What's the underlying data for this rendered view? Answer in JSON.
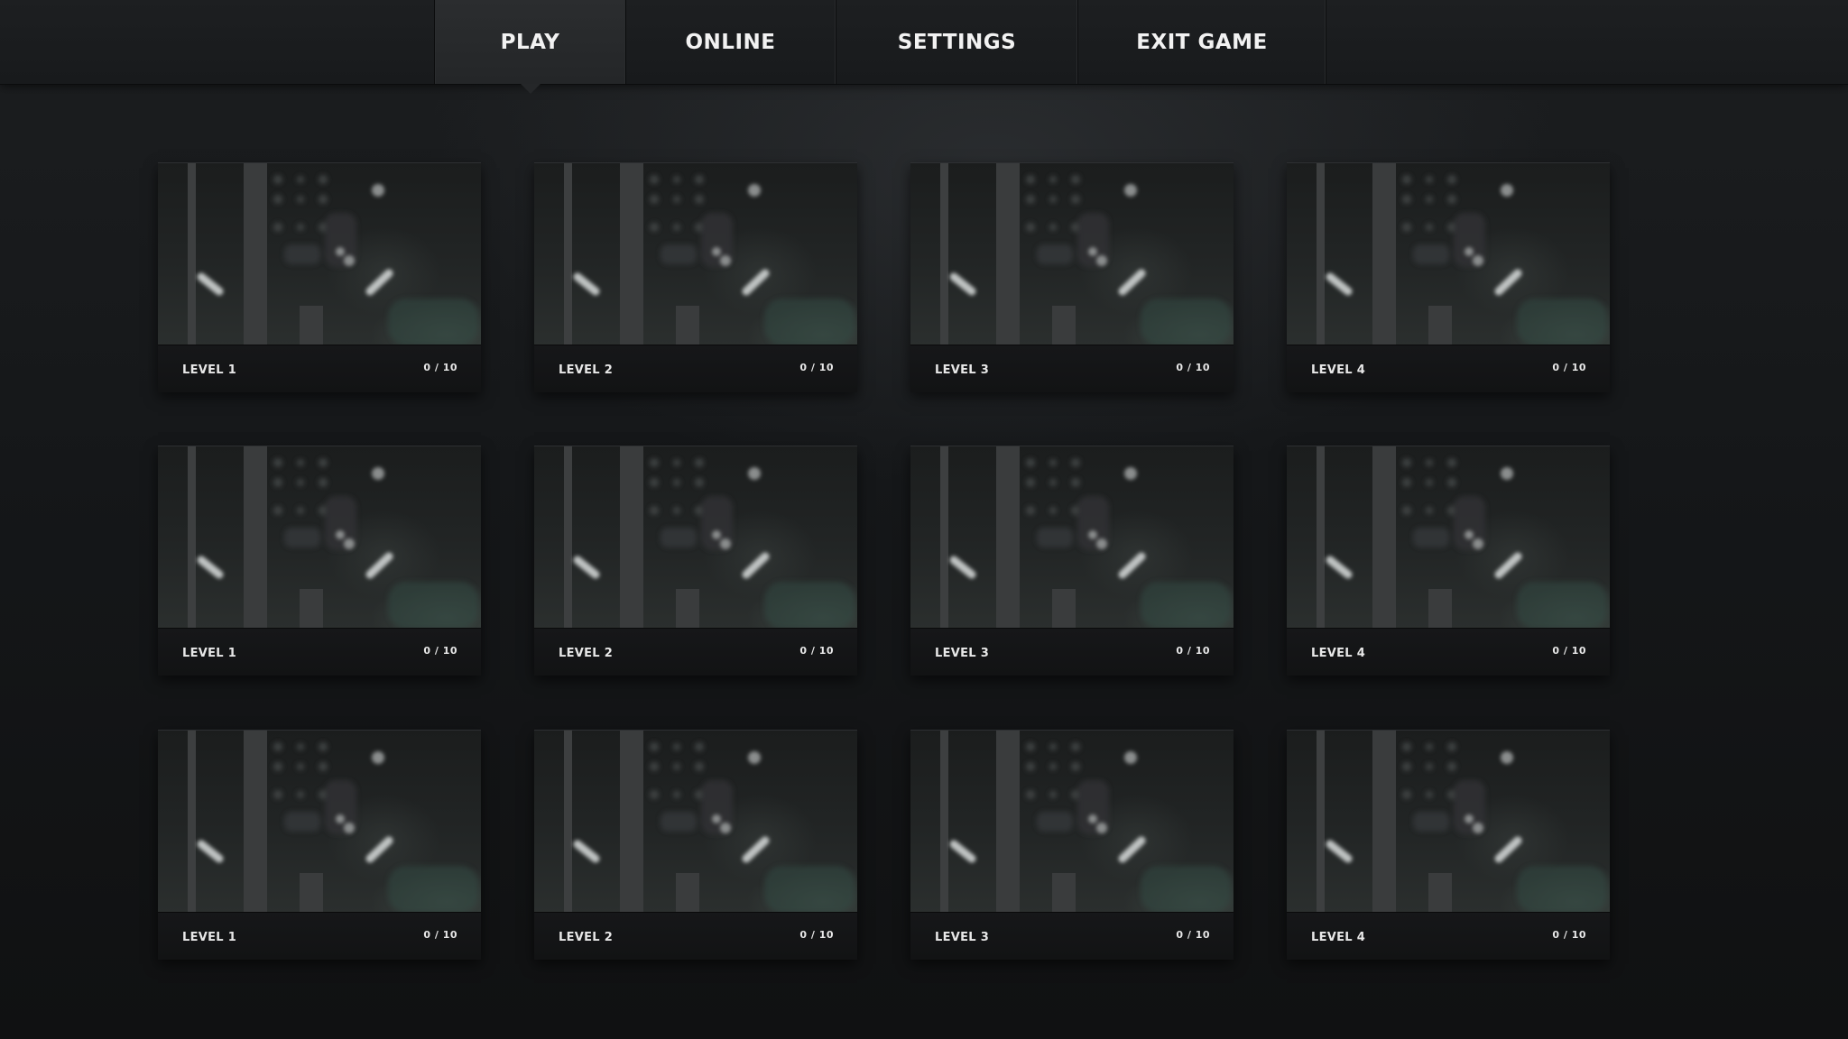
{
  "nav": {
    "tabs": [
      {
        "label": "PLAY",
        "active": true
      },
      {
        "label": "ONLINE",
        "active": false
      },
      {
        "label": "SETTINGS",
        "active": false
      },
      {
        "label": "EXIT GAME",
        "active": false
      }
    ]
  },
  "levels": {
    "rows": [
      [
        {
          "label": "LEVEL 1",
          "score": "0 / 10"
        },
        {
          "label": "LEVEL 2",
          "score": "0 / 10"
        },
        {
          "label": "LEVEL 3",
          "score": "0 / 10"
        },
        {
          "label": "LEVEL 4",
          "score": "0 / 10"
        }
      ],
      [
        {
          "label": "LEVEL 1",
          "score": "0 / 10"
        },
        {
          "label": "LEVEL 2",
          "score": "0 / 10"
        },
        {
          "label": "LEVEL 3",
          "score": "0 / 10"
        },
        {
          "label": "LEVEL 4",
          "score": "0 / 10"
        }
      ],
      [
        {
          "label": "LEVEL 1",
          "score": "0 / 10"
        },
        {
          "label": "LEVEL 2",
          "score": "0 / 10"
        },
        {
          "label": "LEVEL 3",
          "score": "0 / 10"
        },
        {
          "label": "LEVEL 4",
          "score": "0 / 10"
        }
      ]
    ]
  }
}
